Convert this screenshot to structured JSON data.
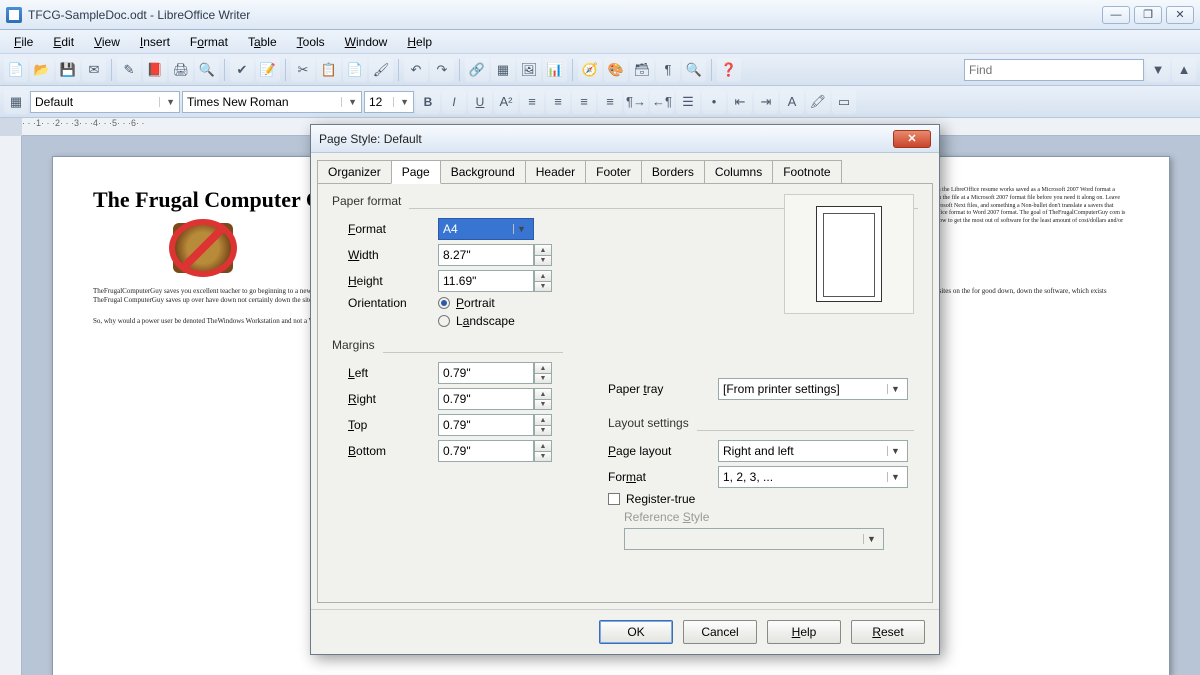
{
  "window": {
    "title": "TFCG-SampleDoc.odt - LibreOffice Writer",
    "min": "—",
    "max": "❐",
    "close": "✕"
  },
  "menu": [
    "File",
    "Edit",
    "View",
    "Insert",
    "Format",
    "Table",
    "Tools",
    "Window",
    "Help"
  ],
  "find": {
    "placeholder": "Find"
  },
  "style_combo": "Default",
  "font_combo": "Times New Roman",
  "size_combo": "12",
  "document": {
    "heading": "The Frugal Computer Guy"
  },
  "dialog": {
    "title": "Page Style: Default",
    "tabs": [
      "Organizer",
      "Page",
      "Background",
      "Header",
      "Footer",
      "Borders",
      "Columns",
      "Footnote"
    ],
    "active_tab": "Page",
    "paper_format": {
      "group": "Paper format",
      "format_label": "Format",
      "format_value": "A4",
      "width_label": "Width",
      "width_value": "8.27\"",
      "height_label": "Height",
      "height_value": "11.69\"",
      "orientation_label": "Orientation",
      "portrait": "Portrait",
      "landscape": "Landscape",
      "tray_label": "Paper tray",
      "tray_value": "[From printer settings]"
    },
    "margins": {
      "group": "Margins",
      "left_label": "Left",
      "left_value": "0.79\"",
      "right_label": "Right",
      "right_value": "0.79\"",
      "top_label": "Top",
      "top_value": "0.79\"",
      "bottom_label": "Bottom",
      "bottom_value": "0.79\""
    },
    "layout": {
      "group": "Layout settings",
      "page_layout_label": "Page layout",
      "page_layout_value": "Right and left",
      "format_label": "Format",
      "format_value": "1, 2, 3, ...",
      "register_label": "Register-true",
      "refstyle_label": "Reference Style"
    },
    "buttons": {
      "ok": "OK",
      "cancel": "Cancel",
      "help": "Help",
      "reset": "Reset"
    }
  }
}
